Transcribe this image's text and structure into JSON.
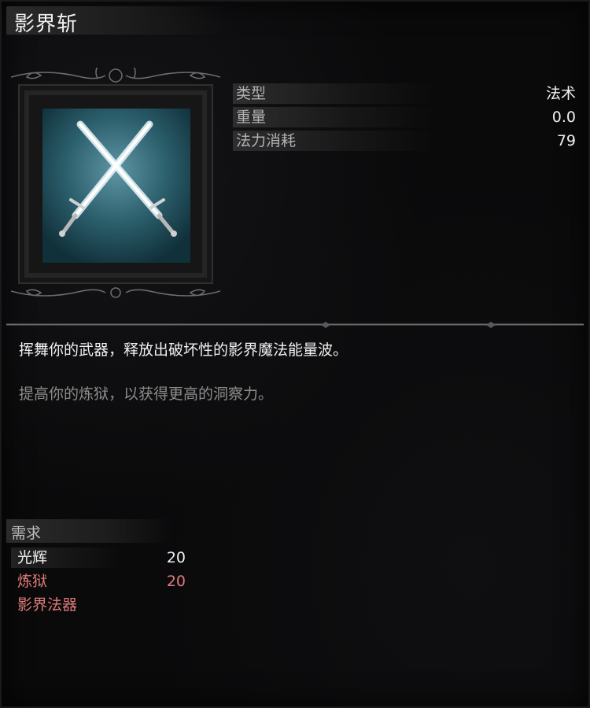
{
  "item": {
    "name": "影界斩",
    "icon": "crossed-swords-icon"
  },
  "stats": [
    {
      "label": "类型",
      "value": "法术"
    },
    {
      "label": "重量",
      "value": "0.0"
    },
    {
      "label": "法力消耗",
      "value": "79"
    }
  ],
  "description": "挥舞你的武器，释放出破坏性的影界魔法能量波。",
  "lore": "提高你的炼狱，以获得更高的洞察力。",
  "requirements": {
    "title": "需求",
    "items": [
      {
        "label": "光辉",
        "value": "20",
        "met": true
      },
      {
        "label": "炼狱",
        "value": "20",
        "met": false
      },
      {
        "label": "影界法器",
        "value": "",
        "met": false
      }
    ]
  },
  "colors": {
    "met": "#f0f0f0",
    "unmet": "#e07a7a",
    "icon_bg": "#1c4a56"
  }
}
